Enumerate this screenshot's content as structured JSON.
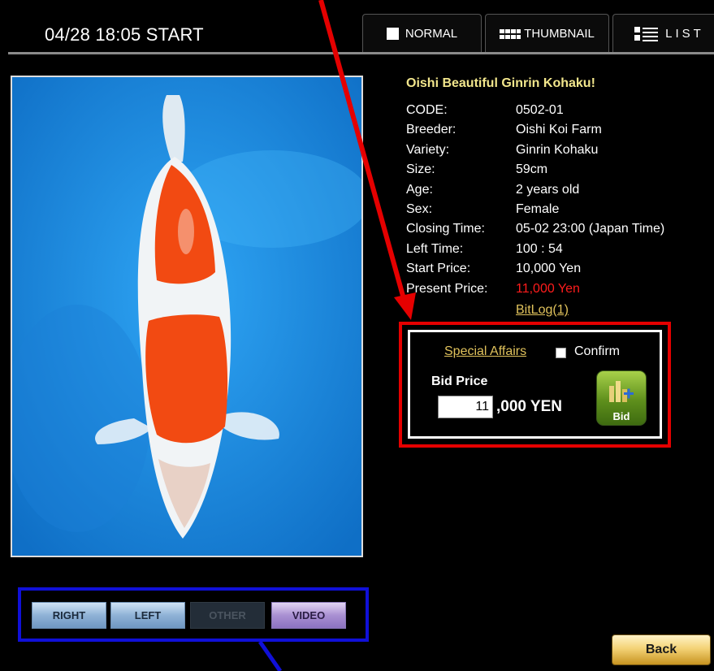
{
  "header": {
    "start_label": "04/28 18:05 START",
    "tabs": [
      {
        "label": "NORMAL",
        "icon": "square-icon"
      },
      {
        "label": "THUMBNAIL",
        "icon": "thumbnail-grid-icon"
      },
      {
        "label": "LIST",
        "icon": "list-icon"
      }
    ]
  },
  "fish": {
    "title": "Oishi Beautiful Ginrin Kohaku!",
    "details": [
      {
        "label": "CODE:",
        "value": "0502-01"
      },
      {
        "label": "Breeder:",
        "value": "Oishi Koi Farm"
      },
      {
        "label": "Variety:",
        "value": "Ginrin Kohaku"
      },
      {
        "label": "Size:",
        "value": "59cm"
      },
      {
        "label": "Age:",
        "value": "2 years old"
      },
      {
        "label": "Sex:",
        "value": "Female"
      },
      {
        "label": "Closing Time:",
        "value": "05-02 23:00 (Japan Time)"
      },
      {
        "label": "Left Time:",
        "value": "100 : 54"
      },
      {
        "label": "Start Price:",
        "value": "10,000 Yen"
      },
      {
        "label": "Present Price:",
        "value": "11,000 Yen"
      }
    ],
    "bitlog_link": "BitLog(1)"
  },
  "bid": {
    "special_affairs_link": "Special Affairs",
    "confirm_label": "Confirm",
    "price_label": "Bid Price",
    "price_value": "11",
    "price_unit": ",000 YEN",
    "button_label": "Bid"
  },
  "photo_views": {
    "buttons": [
      "RIGHT",
      "LEFT",
      "OTHER",
      "VIDEO"
    ]
  },
  "back_label": "Back",
  "colors": {
    "title_yellow": "#f2e68c",
    "present_price_red": "#ff1c1c",
    "link_gold": "#e0c25c",
    "annotation_red": "#e50000",
    "annotation_blue": "#1010d8",
    "water_blue": "#1c8fe6"
  }
}
